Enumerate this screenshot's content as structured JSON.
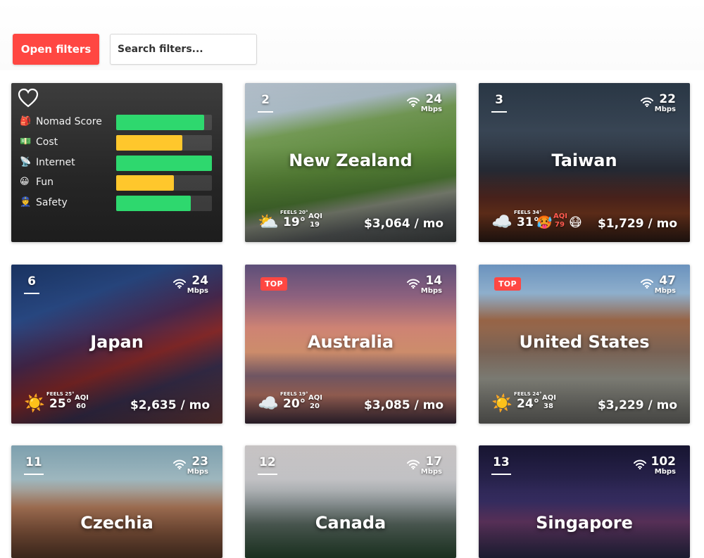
{
  "toolbar": {
    "filters_label": "Open filters",
    "search_placeholder": "Search filters..."
  },
  "score_card": {
    "metrics": [
      {
        "icon": "🎒",
        "label": "Nomad Score",
        "level": 0.92,
        "color": "#2ed86e"
      },
      {
        "icon": "💵",
        "label": "Cost",
        "level": 0.69,
        "color": "#ffc72c"
      },
      {
        "icon": "📡",
        "label": "Internet",
        "level": 1.0,
        "color": "#2ed86e"
      },
      {
        "icon": "😀",
        "label": "Fun",
        "level": 0.6,
        "color": "#ffc72c"
      },
      {
        "icon": "👮",
        "label": "Safety",
        "level": 0.78,
        "color": "#2ed86e"
      }
    ]
  },
  "cities": [
    {
      "rank": "2",
      "name": "New Zealand",
      "speed": "24",
      "unit": "Mbps",
      "feels": "FEELS 20°",
      "temp": "19°",
      "aqi_label": "AQI",
      "aqi": "19",
      "price": "$3,064 / mo",
      "weather_icon": "⛅"
    },
    {
      "rank": "3",
      "name": "Taiwan",
      "speed": "22",
      "unit": "Mbps",
      "feels": "FEELS 34°",
      "temp": "31°",
      "aqi_label": "AQI",
      "aqi": "79",
      "price": "$1,729 / mo",
      "weather_icon": "☁️"
    },
    {
      "rank": "6",
      "name": "Japan",
      "speed": "24",
      "unit": "Mbps",
      "feels": "FEELS 25°",
      "temp": "25°",
      "aqi_label": "AQI",
      "aqi": "60",
      "price": "$2,635 / mo",
      "weather_icon": "☀️"
    },
    {
      "badge": "TOP",
      "name": "Australia",
      "speed": "14",
      "unit": "Mbps",
      "feels": "FEELS 19°",
      "temp": "20°",
      "aqi_label": "AQI",
      "aqi": "20",
      "price": "$3,085 / mo",
      "weather_icon": "☁️"
    },
    {
      "badge": "TOP",
      "name": "United States",
      "speed": "47",
      "unit": "Mbps",
      "feels": "FEELS 24°",
      "temp": "24°",
      "aqi_label": "AQI",
      "aqi": "38",
      "price": "$3,229 / mo",
      "weather_icon": "☀️"
    },
    {
      "rank": "11",
      "name": "Czechia",
      "speed": "23",
      "unit": "Mbps"
    },
    {
      "rank": "12",
      "name": "Canada",
      "speed": "17",
      "unit": "Mbps"
    },
    {
      "rank": "13",
      "name": "Singapore",
      "speed": "102",
      "unit": "Mbps"
    }
  ]
}
